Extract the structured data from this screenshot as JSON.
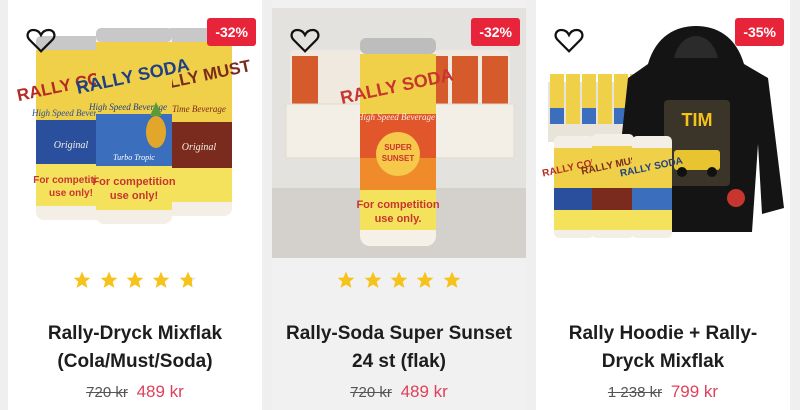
{
  "products": [
    {
      "name": "Rally-Dryck Mixflak (Cola/Must/Soda)",
      "discount": "-32%",
      "old_price": "720 kr",
      "new_price": "489 kr",
      "rating": 4.5,
      "cans": [
        {
          "label": "RALLY COLA",
          "flavor": "High Speed Beverage",
          "footer": "For competition use only!",
          "sub": "Original",
          "color": "#c8352f"
        },
        {
          "label": "RALLY SODA",
          "flavor": "High Speed Beverage",
          "footer": "For competition use only!",
          "sub": "Turbo Tropic",
          "color": "#2a4f9c"
        },
        {
          "label": "RALLY MUST",
          "flavor": "Time Beverage",
          "footer": "For competition use only!",
          "sub": "Original",
          "color": "#6b2b1f"
        }
      ]
    },
    {
      "name": "Rally-Soda Super Sunset 24 st (flak)",
      "discount": "-32%",
      "old_price": "720 kr",
      "new_price": "489 kr",
      "rating": 5,
      "can": {
        "label": "RALLY SODA",
        "flavor": "High Speed Beverage",
        "badge": "SUPER SUNSET",
        "footer": "For competition use only."
      }
    },
    {
      "name": "Rally Hoodie + Rally-Dryck Mixflak",
      "discount": "-35%",
      "old_price": "1 238 kr",
      "new_price": "799 kr",
      "hoodie_print": "TIM"
    }
  ],
  "icons": {
    "wishlist": "heart-icon",
    "rating": "star-icon"
  },
  "colors": {
    "badge": "#e8243b",
    "sale_price": "#e0405a",
    "star": "#f6c21c"
  }
}
